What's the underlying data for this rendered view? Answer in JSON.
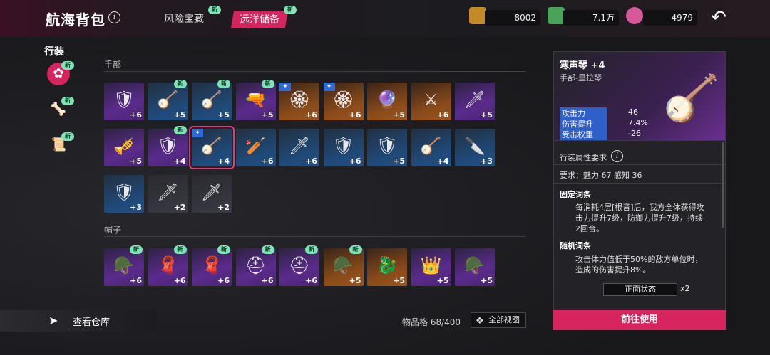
{
  "header": {
    "title": "航海背包",
    "tab_risk": "风险宝藏",
    "tab_ocean": "远洋储备",
    "new_label": "新"
  },
  "currencies": [
    {
      "name": "gold-coins",
      "value": "8002"
    },
    {
      "name": "green-gem",
      "value": "7.1万"
    },
    {
      "name": "pink-crystal",
      "value": "4979"
    }
  ],
  "sidebar": {
    "title": "行装",
    "items": [
      {
        "icon": "pink-emblem-icon",
        "new": "新"
      },
      {
        "icon": "dog-bone-icon",
        "new": "新"
      },
      {
        "icon": "scroll-icon",
        "new": "新"
      }
    ]
  },
  "sections": [
    {
      "label": "手部"
    },
    {
      "label": "帽子"
    }
  ],
  "hand_items": [
    {
      "lvl": "+6",
      "rarity": "purple",
      "art": "🛡",
      "new": "",
      "star": false
    },
    {
      "lvl": "+5",
      "rarity": "blue",
      "art": "🪕",
      "new": "新",
      "star": false
    },
    {
      "lvl": "+5",
      "rarity": "blue",
      "art": "🪕",
      "new": "新",
      "star": false
    },
    {
      "lvl": "+5",
      "rarity": "purple",
      "art": "🔫",
      "new": "新",
      "star": false
    },
    {
      "lvl": "+6",
      "rarity": "orange",
      "art": "🏵",
      "new": "",
      "star": true
    },
    {
      "lvl": "+6",
      "rarity": "orange",
      "art": "🏵",
      "new": "",
      "star": true
    },
    {
      "lvl": "+5",
      "rarity": "orange",
      "art": "🔮",
      "new": "",
      "star": false
    },
    {
      "lvl": "+6",
      "rarity": "orange",
      "art": "⚔",
      "new": "",
      "star": false
    },
    {
      "lvl": "+5",
      "rarity": "purple",
      "art": "🗡",
      "new": "",
      "star": false
    },
    {
      "lvl": "+5",
      "rarity": "purple",
      "art": "🎺",
      "new": "",
      "star": false
    },
    {
      "lvl": "+4",
      "rarity": "purple",
      "art": "🛡",
      "new": "新",
      "star": false
    },
    {
      "lvl": "+4",
      "rarity": "blue",
      "art": "🪕",
      "new": "",
      "star": true
    },
    {
      "lvl": "+6",
      "rarity": "blue",
      "art": "🏏",
      "new": "",
      "star": false
    },
    {
      "lvl": "+6",
      "rarity": "blue",
      "art": "🗡",
      "new": "",
      "star": false
    },
    {
      "lvl": "+6",
      "rarity": "blue",
      "art": "🛡",
      "new": "",
      "star": false
    },
    {
      "lvl": "+5",
      "rarity": "blue",
      "art": "🛡",
      "new": "",
      "star": false
    },
    {
      "lvl": "+4",
      "rarity": "blue",
      "art": "🪕",
      "new": "",
      "star": false
    },
    {
      "lvl": "+3",
      "rarity": "blue",
      "art": "🔪",
      "new": "",
      "star": false
    },
    {
      "lvl": "+3",
      "rarity": "blue",
      "art": "🛡",
      "new": "",
      "star": false
    },
    {
      "lvl": "+2",
      "rarity": "gray",
      "art": "🗡",
      "new": "",
      "star": false
    },
    {
      "lvl": "+2",
      "rarity": "gray",
      "art": "🗡",
      "new": "",
      "star": false
    }
  ],
  "hat_items": [
    {
      "lvl": "+6",
      "rarity": "purple",
      "art": "🪖",
      "new": "新"
    },
    {
      "lvl": "+6",
      "rarity": "purple",
      "art": "🧣",
      "new": "新"
    },
    {
      "lvl": "+6",
      "rarity": "purple",
      "art": "🧣",
      "new": "新"
    },
    {
      "lvl": "+6",
      "rarity": "purple",
      "art": "⛑",
      "new": "新"
    },
    {
      "lvl": "+6",
      "rarity": "purple",
      "art": "⛑",
      "new": "新"
    },
    {
      "lvl": "+5",
      "rarity": "orange",
      "art": "🪖",
      "new": "新"
    },
    {
      "lvl": "+5",
      "rarity": "orange",
      "art": "🐉",
      "new": ""
    },
    {
      "lvl": "+5",
      "rarity": "purple",
      "art": "👑",
      "new": ""
    },
    {
      "lvl": "+5",
      "rarity": "purple",
      "art": "🪖",
      "new": ""
    }
  ],
  "footer": {
    "warehouse": "查看仓库",
    "capacity": "物品格 68/400",
    "all_view": "全部视图"
  },
  "detail": {
    "name": "寒声琴 +4",
    "sub": "手部-里拉琴",
    "stats": [
      {
        "k": "攻击力",
        "v": "46"
      },
      {
        "k": "伤害提升",
        "v": "7.4%"
      },
      {
        "k": "受击权重",
        "v": "-26"
      }
    ],
    "req_title": "行装属性要求",
    "req": "要求：魅力 67 感知 36",
    "fixed_title": "固定词条",
    "fixed_text1": "每消耗4层[根音]后，我方全体获得攻",
    "fixed_text2": "击力提升7级，防御力提升7级，持续",
    "fixed_text3": "2回合。",
    "random_title": "随机词条",
    "random_text1": "攻击体力值低于50%的敌方单位时，",
    "random_text2": "造成的伤害提升8%。",
    "chip": "正面状态",
    "chip_count": "x2",
    "use": "前往使用"
  }
}
